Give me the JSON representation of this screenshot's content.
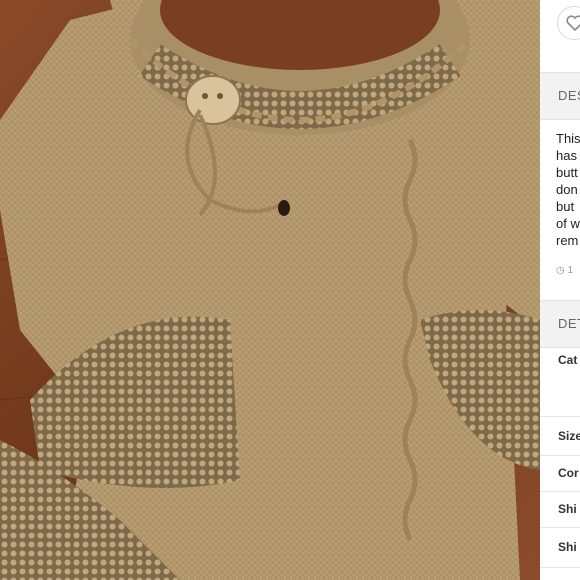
{
  "listing": {
    "photo_alt": "photo",
    "favorite_icon": "heart-icon"
  },
  "description": {
    "heading": "DES",
    "lines": [
      "This",
      "has",
      "butt",
      "don",
      "but",
      "of w",
      "rem"
    ],
    "meta": "1"
  },
  "details": {
    "heading": "DET",
    "rows": [
      {
        "label": "Cat"
      },
      {
        "label": "Size"
      },
      {
        "label": "Cor"
      },
      {
        "label": "Shi"
      },
      {
        "label": "Shi"
      }
    ]
  },
  "colors": {
    "sweater": "#b99d72",
    "wood": "#7a3f22",
    "panel_band": "#f2f2f2"
  }
}
